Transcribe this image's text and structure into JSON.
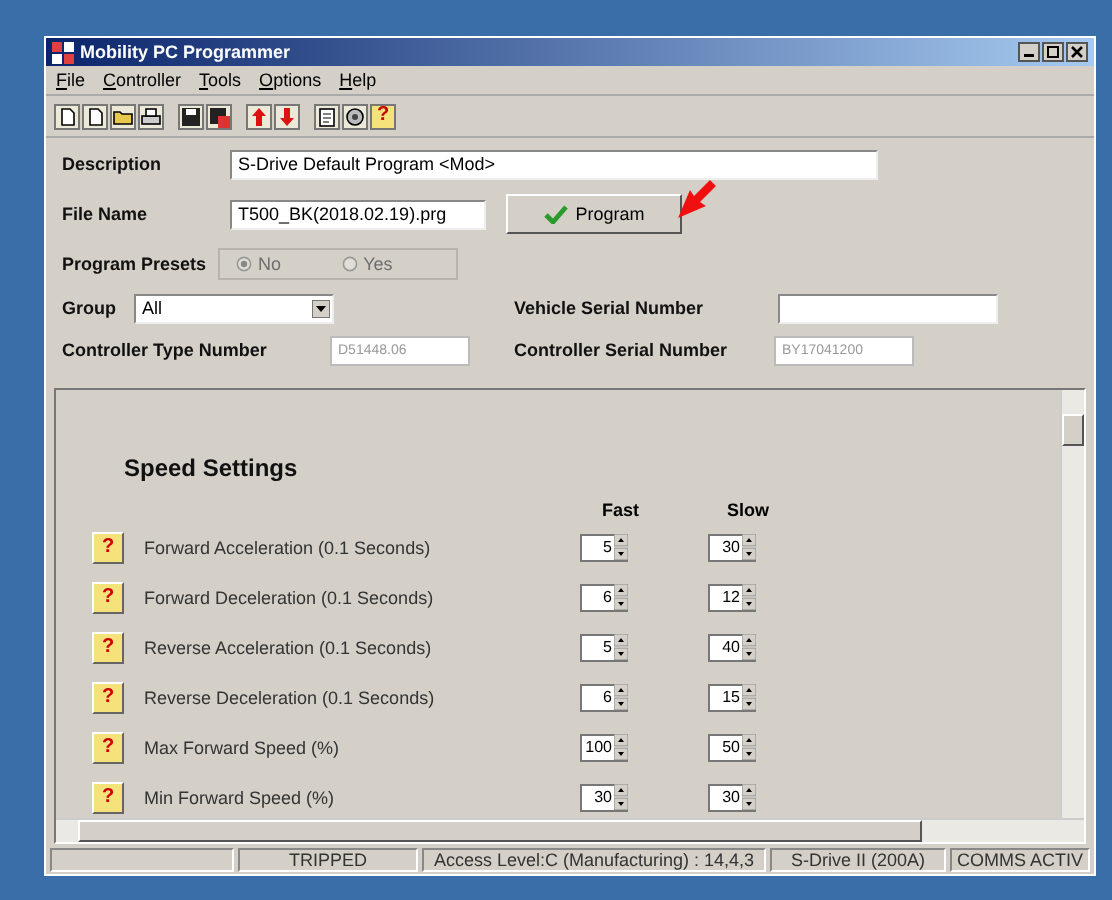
{
  "window": {
    "title": "Mobility PC Programmer"
  },
  "menu": [
    "File",
    "Controller",
    "Tools",
    "Options",
    "Help"
  ],
  "toolbar": [
    {
      "kind": "new"
    },
    {
      "kind": "copy"
    },
    {
      "kind": "open"
    },
    {
      "kind": "print"
    },
    {
      "kind": "save"
    },
    {
      "kind": "saveall"
    },
    {
      "kind": "up"
    },
    {
      "kind": "down"
    },
    {
      "kind": "report"
    },
    {
      "kind": "lock"
    },
    {
      "kind": "help",
      "label": "?"
    }
  ],
  "form": {
    "description_label": "Description",
    "description": "S-Drive Default Program <Mod>",
    "file_name_label": "File Name",
    "file_name": "T500_BK(2018.02.19).prg",
    "program_button": "Program",
    "presets_label": "Program Presets",
    "presets": [
      {
        "label": "No",
        "selected": true,
        "disabled": true
      },
      {
        "label": "Yes",
        "selected": false,
        "disabled": true
      }
    ],
    "group_label": "Group",
    "group": "All",
    "vehicle_serial_label": "Vehicle Serial Number",
    "controller_type_label": "Controller Type Number",
    "controller_type": "D51448.06",
    "controller_serial_label": "Controller Serial Number",
    "controller_serial": "BY17041200"
  },
  "speed_settings": {
    "title": "Speed Settings",
    "columns": [
      "Fast",
      "Slow"
    ],
    "rows": [
      {
        "help": "?",
        "label": "Forward Acceleration (0.1 Seconds)",
        "fast": "5",
        "slow": "30"
      },
      {
        "help": "?",
        "label": "Forward Deceleration (0.1 Seconds)",
        "fast": "6",
        "slow": "12"
      },
      {
        "help": "?",
        "label": "Reverse Acceleration (0.1 Seconds)",
        "fast": "5",
        "slow": "40"
      },
      {
        "help": "?",
        "label": "Reverse Deceleration (0.1 Seconds)",
        "fast": "6",
        "slow": "15"
      },
      {
        "help": "?",
        "label": "Max Forward Speed (%)",
        "fast": "100",
        "slow": "50"
      },
      {
        "help": "?",
        "label": "Min Forward Speed (%)",
        "fast": "30",
        "slow": "30"
      }
    ]
  },
  "status_bar": [
    "TRIPPED",
    "Access Level:C (Manufacturing) : 14,4,3",
    "S-Drive II (200A)",
    "COMMS ACTIV"
  ]
}
